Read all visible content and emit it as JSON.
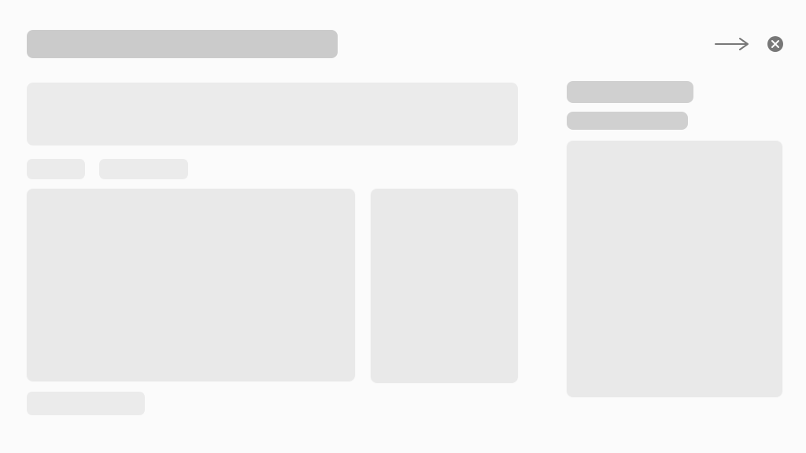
{
  "header": {
    "title_placeholder": "",
    "actions": [
      {
        "name": "next-arrow-icon"
      },
      {
        "name": "close-icon"
      }
    ]
  },
  "main": {
    "hero_card": {
      "state": "loading"
    },
    "chips": [
      {
        "state": "loading"
      },
      {
        "state": "loading"
      }
    ],
    "content_card": {
      "state": "loading"
    },
    "side_card": {
      "state": "loading"
    },
    "footer_chip": {
      "state": "loading"
    }
  },
  "aside": {
    "title": {
      "state": "loading"
    },
    "subtitle": {
      "state": "loading"
    },
    "preview_card": {
      "state": "loading"
    }
  },
  "colors": {
    "background": "#fbfbfb",
    "skeleton_dark": "#cbcbcb",
    "skeleton_light": "#ebebeb",
    "icon": "#777777"
  }
}
